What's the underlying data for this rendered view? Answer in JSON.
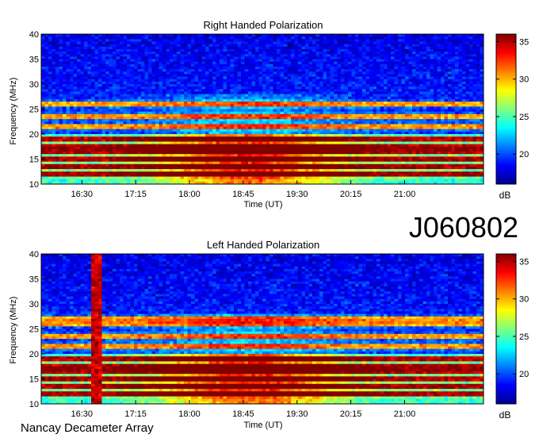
{
  "id_label": "J060802",
  "footer": "Nancay Decameter Array",
  "chart_data": [
    {
      "type": "heatmap",
      "title": "Right Handed Polarization",
      "xlabel": "Time (UT)",
      "ylabel": "Frequency (MHz)",
      "xticks": [
        "16:30",
        "17:15",
        "18:00",
        "18:45",
        "19:30",
        "20:15",
        "21:00"
      ],
      "xrange": [
        "15:56",
        "22:06"
      ],
      "ylim": [
        10,
        40
      ],
      "yticks": [
        10,
        15,
        20,
        25,
        30,
        35,
        40
      ],
      "colorbar": {
        "label": "dB",
        "ticks": [
          20,
          25,
          30,
          35
        ],
        "range": [
          16,
          36
        ],
        "colormap": "jet"
      },
      "strong_bands_mhz": [
        12,
        13.5,
        15,
        16.5,
        17.5,
        19,
        21.5,
        23.5,
        26
      ],
      "burst_times": []
    },
    {
      "type": "heatmap",
      "title": "Left Handed Polarization",
      "xlabel": "Time (UT)",
      "ylabel": "Frequency (MHz)",
      "xticks": [
        "16:30",
        "17:15",
        "18:00",
        "18:45",
        "19:30",
        "20:15",
        "21:00"
      ],
      "xrange": [
        "15:56",
        "22:06"
      ],
      "ylim": [
        10,
        40
      ],
      "yticks": [
        10,
        15,
        20,
        25,
        30,
        35,
        40
      ],
      "colorbar": {
        "label": "dB",
        "ticks": [
          20,
          25,
          30,
          35
        ],
        "range": [
          16,
          36
        ],
        "colormap": "jet"
      },
      "strong_bands_mhz": [
        12,
        13.5,
        15,
        16.5,
        17.5,
        19,
        21.5,
        23.5,
        26,
        27
      ],
      "burst_times": [
        "16:40",
        "16:44"
      ]
    }
  ]
}
